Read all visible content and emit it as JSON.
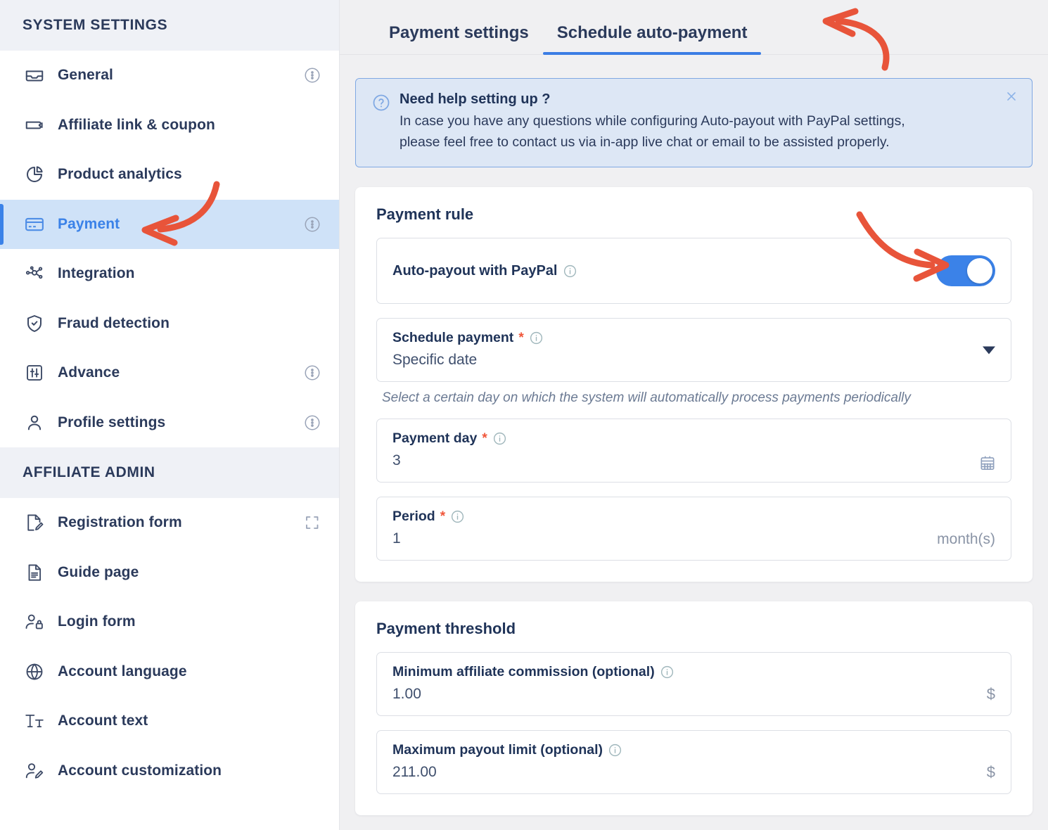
{
  "sidebar": {
    "sections": [
      {
        "title": "SYSTEM SETTINGS",
        "items": [
          {
            "label": "General",
            "icon": "inbox-icon",
            "trailing": "more-options-icon",
            "active": false
          },
          {
            "label": "Affiliate link & coupon",
            "icon": "ticket-icon",
            "trailing": "",
            "active": false
          },
          {
            "label": "Product analytics",
            "icon": "pie-chart-icon",
            "trailing": "",
            "active": false
          },
          {
            "label": "Payment",
            "icon": "credit-card-icon",
            "trailing": "more-options-icon",
            "active": true
          },
          {
            "label": "Integration",
            "icon": "nodes-icon",
            "trailing": "",
            "active": false
          },
          {
            "label": "Fraud detection",
            "icon": "shield-check-icon",
            "trailing": "",
            "active": false
          },
          {
            "label": "Advance",
            "icon": "sliders-icon",
            "trailing": "more-options-icon",
            "active": false
          },
          {
            "label": "Profile settings",
            "icon": "user-icon",
            "trailing": "more-options-icon",
            "active": false
          }
        ]
      },
      {
        "title": "AFFILIATE ADMIN",
        "items": [
          {
            "label": "Registration form",
            "icon": "form-edit-icon",
            "trailing": "expand-icon",
            "active": false
          },
          {
            "label": "Guide page",
            "icon": "document-icon",
            "trailing": "",
            "active": false
          },
          {
            "label": "Login form",
            "icon": "user-lock-icon",
            "trailing": "",
            "active": false
          },
          {
            "label": "Account language",
            "icon": "globe-icon",
            "trailing": "",
            "active": false
          },
          {
            "label": "Account text",
            "icon": "text-size-icon",
            "trailing": "",
            "active": false
          },
          {
            "label": "Account customization",
            "icon": "user-edit-icon",
            "trailing": "",
            "active": false
          }
        ]
      }
    ]
  },
  "main": {
    "tabs": [
      {
        "label": "Payment settings",
        "active": false
      },
      {
        "label": "Schedule auto-payment",
        "active": true
      }
    ],
    "banner": {
      "icon": "question-circle-icon",
      "title": "Need help setting up ?",
      "line1": "In case you have any questions while configuring Auto-payout with PayPal settings,",
      "line2": "please feel free to contact us via in-app live chat or email to be assisted properly.",
      "close_icon": "close-icon"
    },
    "payment_rule": {
      "title": "Payment rule",
      "auto_payout": {
        "label": "Auto-payout with PayPal",
        "info_icon": "info-icon",
        "toggle_state": "on"
      },
      "schedule_payment": {
        "label": "Schedule payment",
        "required": "*",
        "info_icon": "info-icon",
        "value": "Specific date",
        "dropdown_icon": "chevron-down-icon",
        "helper": "Select a certain day on which the system will automatically process payments periodically"
      },
      "payment_day": {
        "label": "Payment day",
        "required": "*",
        "info_icon": "info-icon",
        "value": "3",
        "trailing_icon": "calendar-icon"
      },
      "period": {
        "label": "Period",
        "required": "*",
        "info_icon": "info-icon",
        "value": "1",
        "suffix": "month(s)"
      }
    },
    "payment_threshold": {
      "title": "Payment threshold",
      "minimum_commission": {
        "label": "Minimum affiliate commission (optional)",
        "info_icon": "info-icon",
        "value": "1.00",
        "suffix": "$"
      },
      "maximum_payout": {
        "label": "Maximum payout limit (optional)",
        "info_icon": "info-icon",
        "value": "211.00",
        "suffix": "$"
      }
    }
  },
  "annotations": {
    "arrow_color": "#e8543a",
    "arrow_to_payment_tab": "curved-arrow-pointing-to-schedule-auto-payment-tab",
    "arrow_to_sidebar_payment": "curved-arrow-pointing-to-payment-sidebar-item",
    "arrow_to_toggle": "curved-arrow-pointing-to-auto-payout-toggle"
  },
  "colors": {
    "accent_blue": "#3b82e8",
    "active_nav_bg": "#cfe2f8",
    "banner_bg": "#dde7f5",
    "banner_border": "#7fa8e3",
    "text_navy": "#1f3358",
    "required_red": "#f0563a",
    "page_bg": "#f0f0f2"
  }
}
